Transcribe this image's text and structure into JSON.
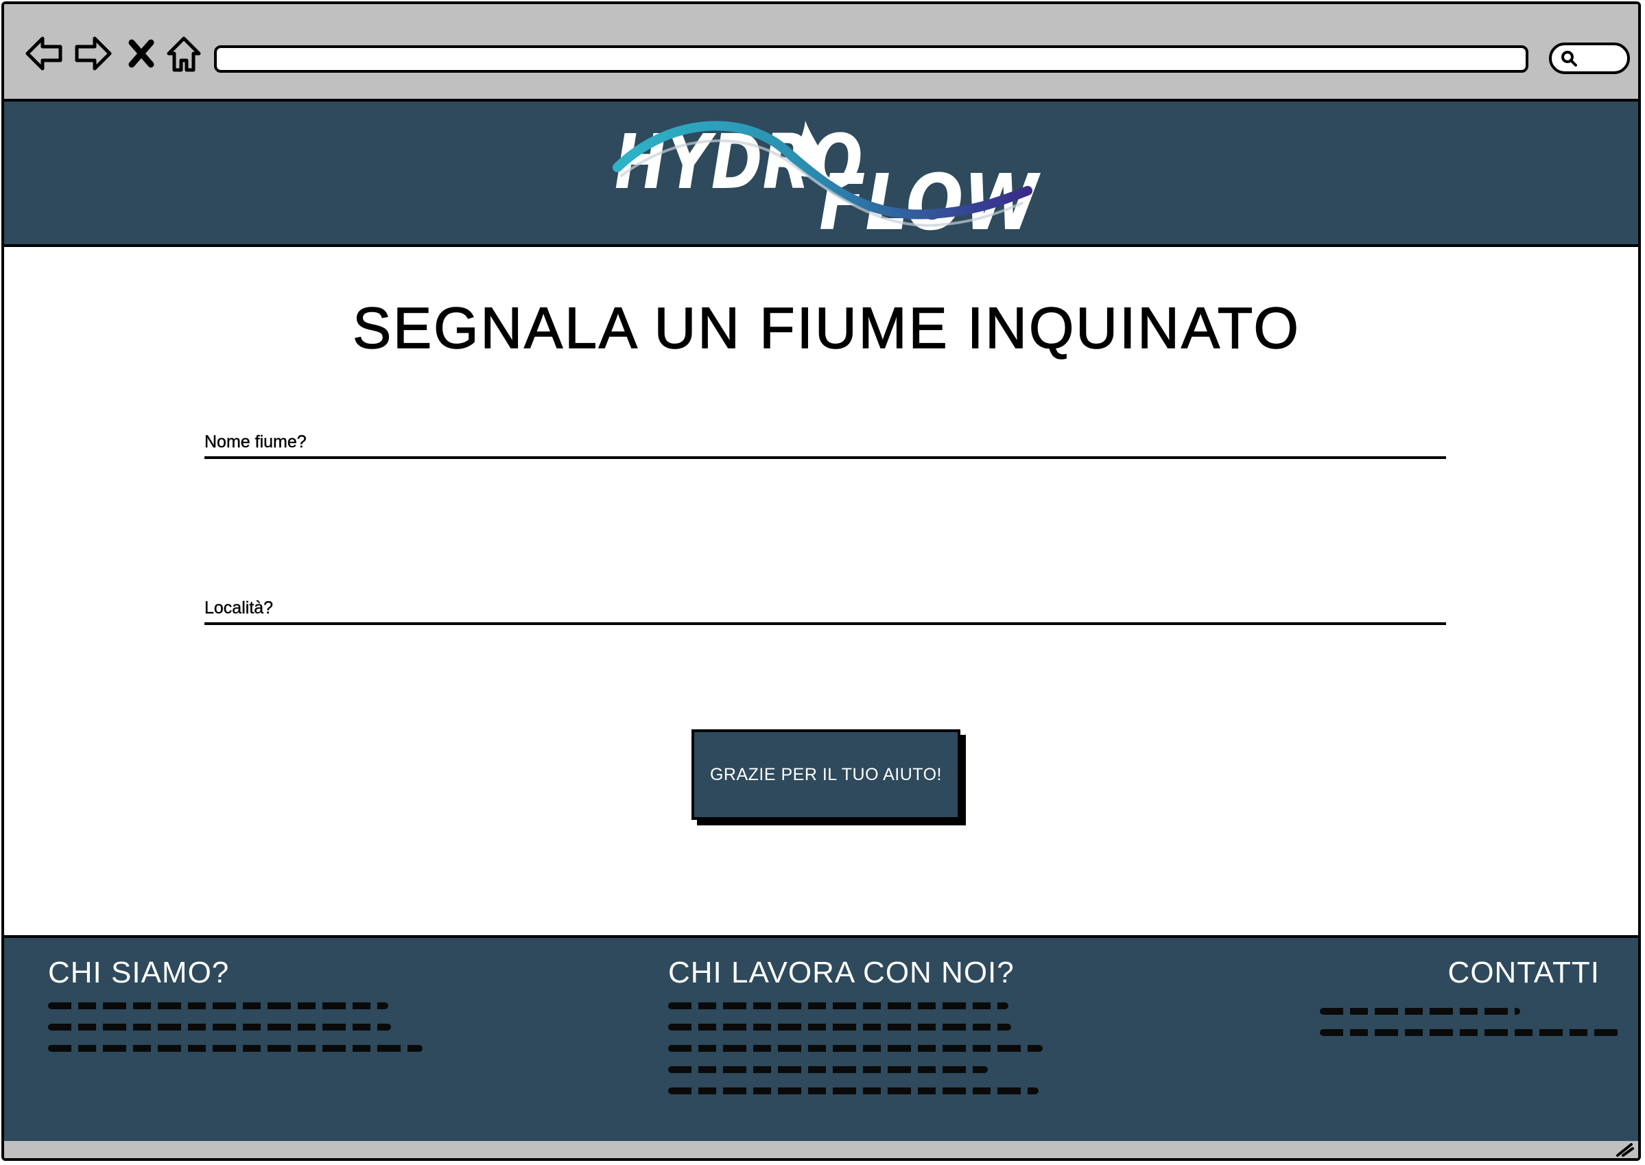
{
  "header": {
    "logo_text_left": "HYDRO",
    "logo_text_right": "FLOW"
  },
  "main": {
    "title": "SEGNALA UN FIUME INQUINATO",
    "fields": [
      {
        "label": "Nome fiume?"
      },
      {
        "label": "Località?"
      }
    ],
    "submit_label": "GRAZIE PER IL TUO AIUTO!"
  },
  "footer": {
    "about_heading": "CHI SIAMO?",
    "work_heading": "CHI LAVORA CON NOI?",
    "contacts_heading": "CONTATTI"
  },
  "colors": {
    "brand": "#2e4a5c",
    "chrome": "#c0c0c0",
    "logo_wave_start": "#2fb3c9",
    "logo_wave_end": "#3a2a8a"
  },
  "icons": [
    "back-arrow-icon",
    "forward-arrow-icon",
    "close-icon",
    "home-icon",
    "search-icon",
    "resize-grip-icon"
  ]
}
